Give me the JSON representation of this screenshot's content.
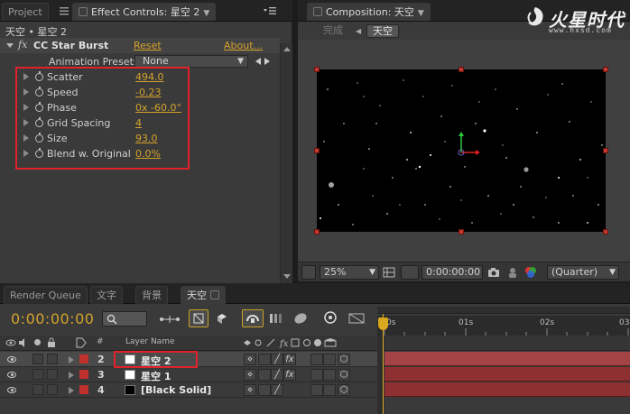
{
  "left_tabs": {
    "project": "Project",
    "effect_controls": "Effect Controls: 星空 2"
  },
  "effect_controls": {
    "breadcrumb": "天空 • 星空 2",
    "fx_symbol": "fx",
    "effect_name": "CC Star Burst",
    "reset": "Reset",
    "about": "About...",
    "presets_label": "Animation Presets:",
    "presets_value": "None",
    "properties": [
      {
        "label": "Scatter",
        "value": "494.0"
      },
      {
        "label": "Speed",
        "value": "-0.23"
      },
      {
        "label": "Phase",
        "value": "0x -60.0°"
      },
      {
        "label": "Grid Spacing",
        "value": "4"
      },
      {
        "label": "Size",
        "value": "93.0"
      },
      {
        "label": "Blend w. Original",
        "value": "0.0%"
      }
    ]
  },
  "composition": {
    "tab": "Composition: 天空",
    "done": "完成",
    "current": "天空",
    "zoom": "25%",
    "timecode": "0:00:00:00",
    "resolution": "(Quarter)"
  },
  "logo": {
    "text": "火星时代",
    "url": "www.hxsd.com"
  },
  "timeline_tabs": [
    "Render Queue",
    "文字",
    "背景",
    "天空"
  ],
  "timeline": {
    "timecode": "0:00:00:00",
    "ruler": [
      "0s",
      "01s",
      "02s",
      "03"
    ],
    "col_hash": "#",
    "col_layer_name": "Layer Name",
    "layers": [
      {
        "num": "2",
        "name": "星空 2",
        "thumb": "#ffffff",
        "selected": true
      },
      {
        "num": "3",
        "name": "星空 1",
        "thumb": "#ffffff",
        "selected": false
      },
      {
        "num": "4",
        "name": "[Black Solid]",
        "thumb": "#000000",
        "selected": false
      }
    ]
  },
  "colors": {
    "accent": "#d4a22c",
    "highlight": "#e0222a",
    "layer_bar": "#8e2f31"
  }
}
